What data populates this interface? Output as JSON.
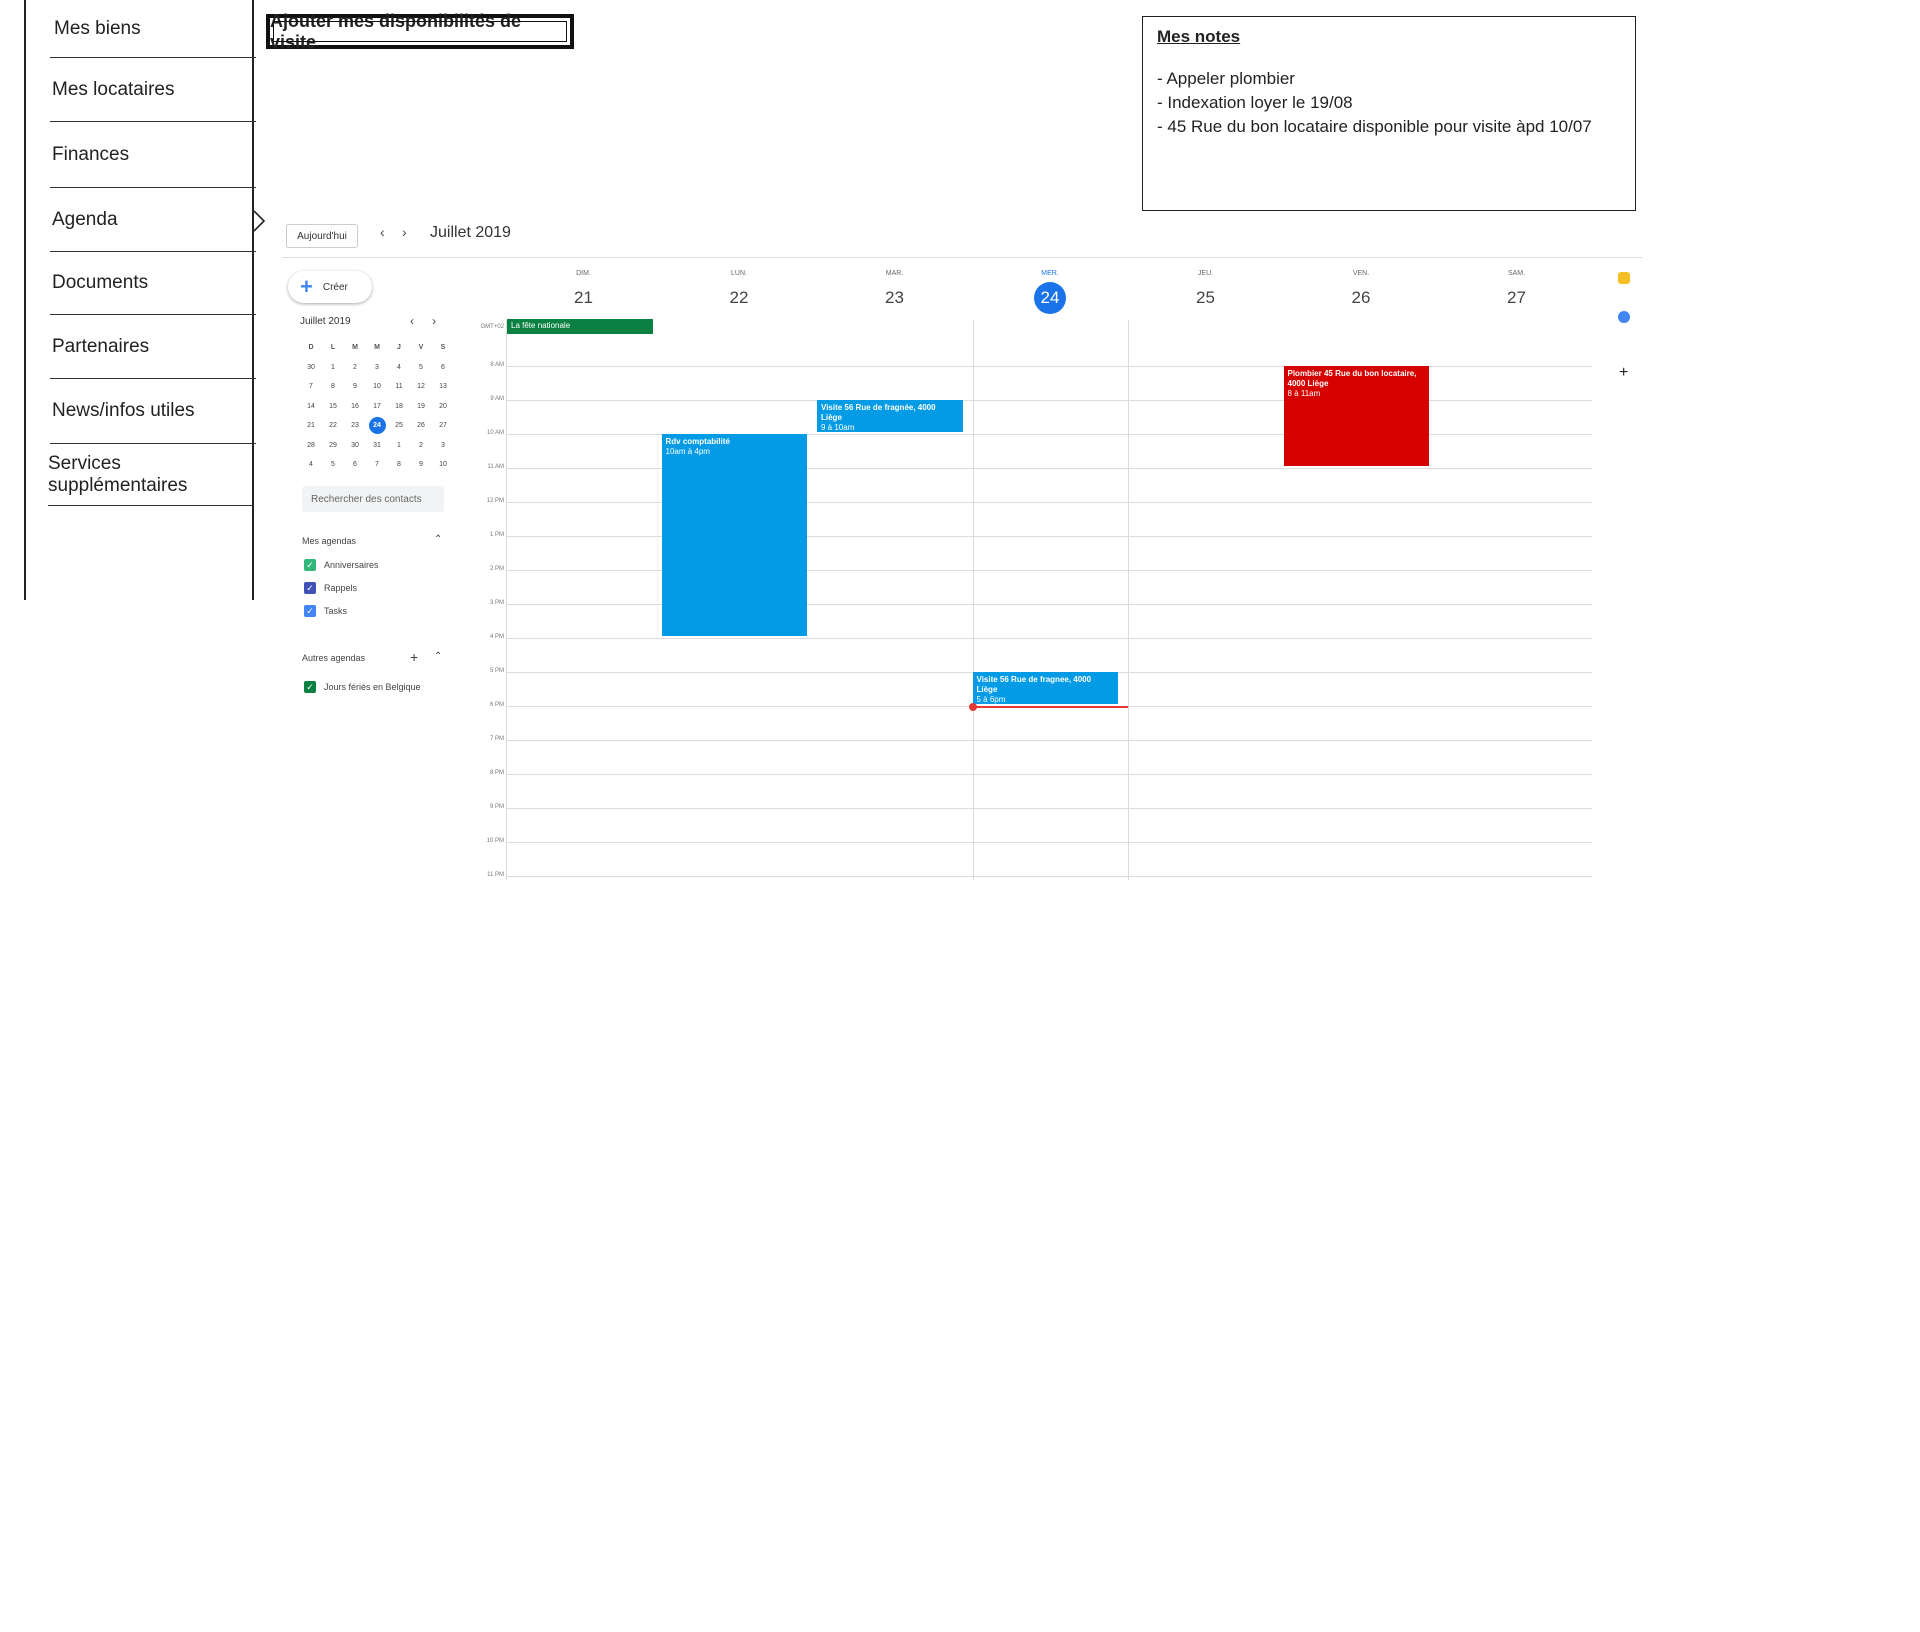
{
  "sidebar": {
    "items": [
      {
        "label": "Mes biens"
      },
      {
        "label": "Mes locataires"
      },
      {
        "label": "Finances"
      },
      {
        "label": "Agenda"
      },
      {
        "label": "Documents"
      },
      {
        "label": "Partenaires"
      },
      {
        "label": "News/infos utiles"
      },
      {
        "label": "Services supplémentaires"
      }
    ],
    "active": "Agenda"
  },
  "header": {
    "add_availability_label": "Ajouter mes disponibilités de visite"
  },
  "notes": {
    "title": "Mes notes",
    "lines": [
      "- Appeler plombier",
      "- Indexation loyer le 19/08",
      "- 45 Rue du bon locataire disponible pour visite àpd 10/07"
    ]
  },
  "calendar": {
    "today_label": "Aujourd'hui",
    "month_title": "Juillet 2019",
    "create_label": "Créer",
    "mini": {
      "title": "Juillet 2019",
      "day_heads": [
        "D",
        "L",
        "M",
        "M",
        "J",
        "V",
        "S"
      ],
      "weeks": [
        [
          "30",
          "1",
          "2",
          "3",
          "4",
          "5",
          "6"
        ],
        [
          "7",
          "8",
          "9",
          "10",
          "11",
          "12",
          "13"
        ],
        [
          "14",
          "15",
          "16",
          "17",
          "18",
          "19",
          "20"
        ],
        [
          "21",
          "22",
          "23",
          "24",
          "25",
          "26",
          "27"
        ],
        [
          "28",
          "29",
          "30",
          "31",
          "1",
          "2",
          "3"
        ],
        [
          "4",
          "5",
          "6",
          "7",
          "8",
          "9",
          "10"
        ]
      ],
      "today": "24"
    },
    "search_contacts_placeholder": "Rechercher des contacts",
    "my_calendars_title": "Mes agendas",
    "my_calendars": [
      {
        "label": "Anniversaires",
        "color": "#33b679"
      },
      {
        "label": "Rappels",
        "color": "#3f51b5"
      },
      {
        "label": "Tasks",
        "color": "#4285f4"
      }
    ],
    "other_calendars_title": "Autres agendas",
    "other_calendars": [
      {
        "label": "Jours fériés en Belgique",
        "color": "#0b8043"
      }
    ],
    "days": [
      {
        "name": "DIM.",
        "num": "21"
      },
      {
        "name": "LUN.",
        "num": "22"
      },
      {
        "name": "MAR.",
        "num": "23"
      },
      {
        "name": "MER.",
        "num": "24",
        "today": true
      },
      {
        "name": "JEU.",
        "num": "25"
      },
      {
        "name": "VEN.",
        "num": "26"
      },
      {
        "name": "SAM.",
        "num": "27"
      }
    ],
    "allday_label": "GMT+02",
    "hours": [
      "8 AM",
      "9 AM",
      "10 AM",
      "11 AM",
      "12 PM",
      "1 PM",
      "2 PM",
      "3 PM",
      "4 PM",
      "5 PM",
      "6 PM",
      "7 PM",
      "8 PM",
      "9 PM",
      "10 PM",
      "11 PM"
    ],
    "allday_event": {
      "title": "La fête nationale",
      "day": 0,
      "color": "#0b8043"
    },
    "events": [
      {
        "title": "Rdv comptabilité",
        "time": "10am à 4pm",
        "day": 1,
        "start": 10,
        "end": 16,
        "color": "#039be5"
      },
      {
        "title": "Visite 56 Rue de fragnée, 4000 Liège",
        "time": "9 à 10am",
        "day": 2,
        "start": 9,
        "end": 10,
        "color": "#039be5"
      },
      {
        "title": "Visite 56 Rue de fragnee, 4000 Liège",
        "time": "5 à 6pm",
        "day": 3,
        "start": 17,
        "end": 18,
        "color": "#039be5"
      },
      {
        "title": "Plombier 45 Rue du bon locataire, 4000 Liège",
        "time": "8 à 11am",
        "day": 5,
        "start": 8,
        "end": 11,
        "color": "#d50000"
      }
    ],
    "now_hour": 18,
    "side_icons": [
      "keep-icon",
      "tasks-icon"
    ]
  }
}
